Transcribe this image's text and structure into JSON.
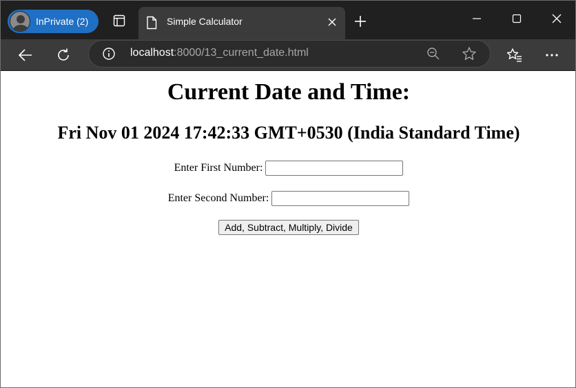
{
  "browser": {
    "inprivate_label": "InPrivate (2)",
    "tab_title": "Simple Calculator",
    "url_host": "localhost",
    "url_rest": ":8000/13_current_date.html"
  },
  "page": {
    "heading": "Current Date and Time:",
    "datetime": "Fri Nov 01 2024 17:42:33 GMT+0530 (India Standard Time)",
    "first_label": "Enter First Number:",
    "first_value": "",
    "second_label": "Enter Second Number:",
    "second_value": "",
    "button_label": "Add, Subtract, Multiply, Divide"
  },
  "colors": {
    "tabstrip": "#202020",
    "toolbar": "#3b3b3b",
    "inprivate_pill": "#1f6fc4"
  }
}
